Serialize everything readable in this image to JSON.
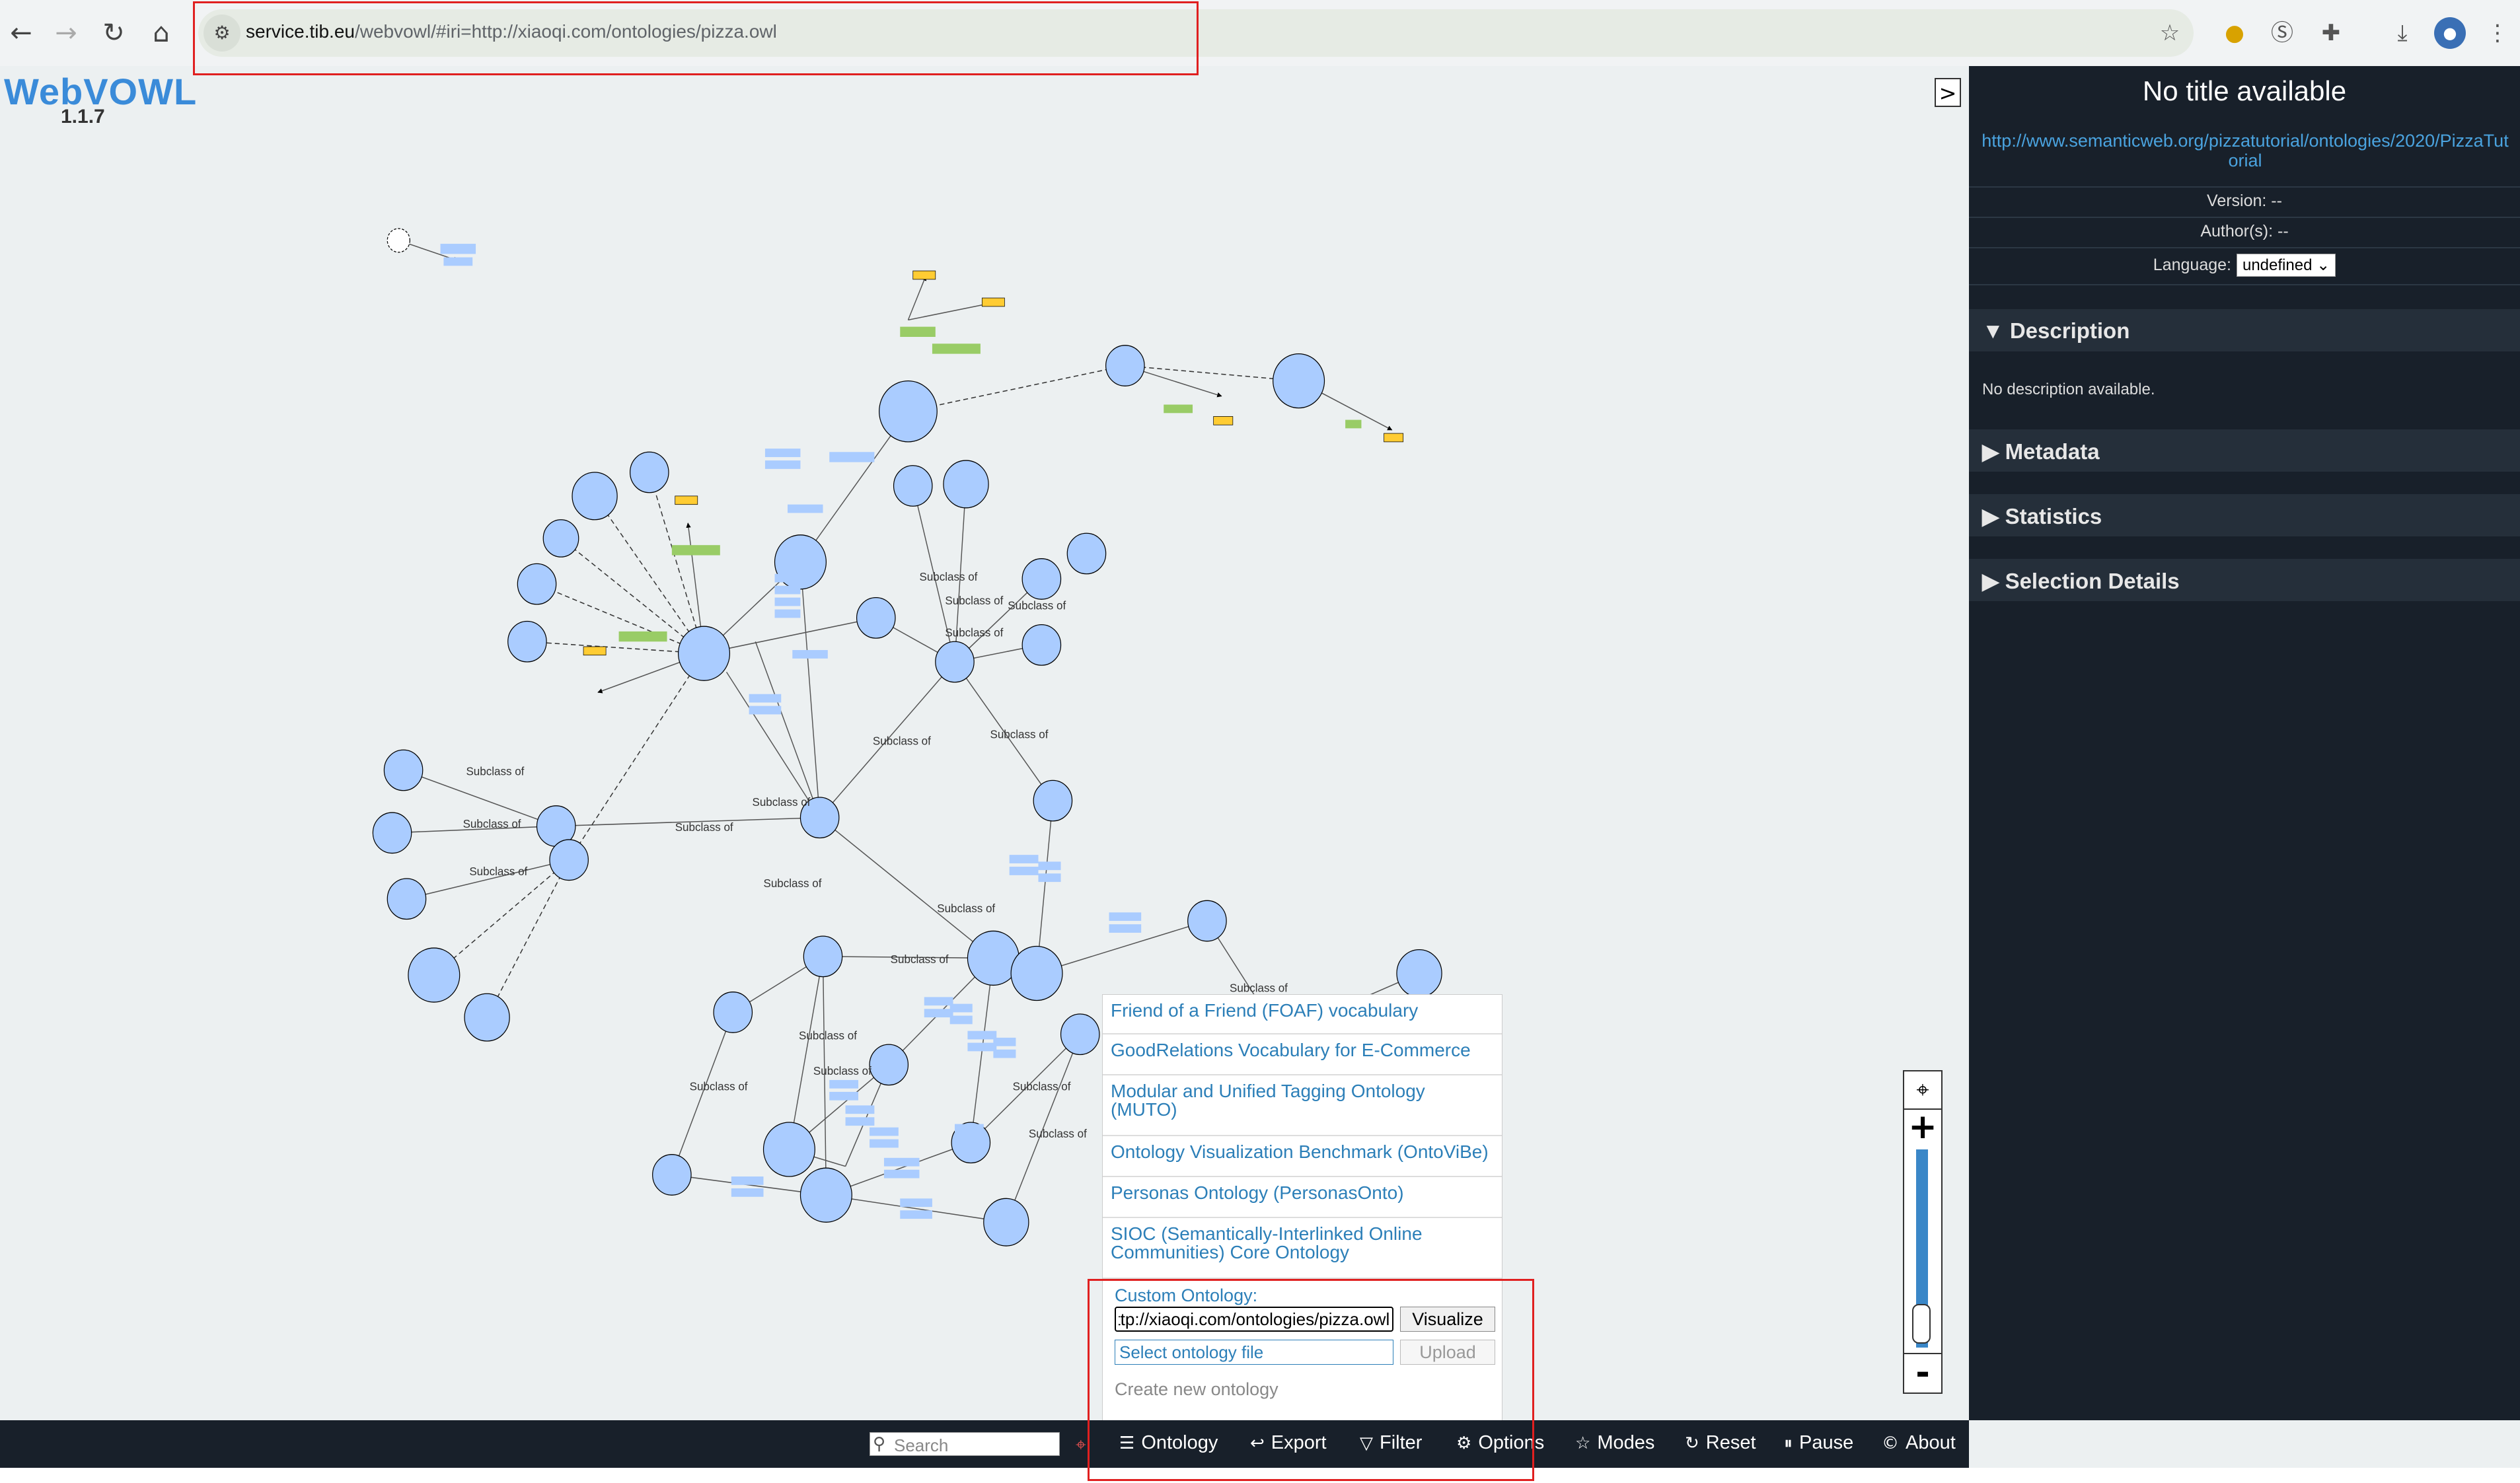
{
  "browser": {
    "url_host": "service.tib.eu",
    "url_path": "/webvowl/#iri=http://xiaoqi.com/ontologies/pizza.owl",
    "icons": [
      "back-icon",
      "forward-icon",
      "reload-icon",
      "home-icon",
      "site-info-icon",
      "bookmark-star-icon",
      "extension-medal-icon",
      "extension-s-icon",
      "extensions-puzzle-icon",
      "download-icon",
      "profile-avatar",
      "menu-kebab-icon"
    ]
  },
  "app": {
    "logo": "WebVOWL",
    "version": "1.1.7",
    "toggle_sidebar": ">"
  },
  "sidebar": {
    "title": "No title available",
    "iri": "http://www.semanticweb.org/pizzatutorial/ontologies/2020/PizzaTutorial",
    "version": "Version: --",
    "authors": "Author(s): --",
    "language_label": "Language:",
    "language_value": "undefined",
    "sections": [
      {
        "arrow": "▼",
        "label": "Description"
      },
      {
        "arrow": "▶",
        "label": "Metadata"
      },
      {
        "arrow": "▶",
        "label": "Statistics"
      },
      {
        "arrow": "▶",
        "label": "Selection Details"
      }
    ],
    "description_text": "No description available."
  },
  "zoom": {
    "locate": "⌖",
    "plus": "+",
    "minus": "-",
    "level": 0.8
  },
  "ontology_menu": {
    "items": [
      "Friend of a Friend (FOAF) vocabulary",
      "GoodRelations Vocabulary for E-Commerce",
      "Modular and Unified Tagging Ontology (MUTO)",
      "Ontology Visualization Benchmark (OntoViBe)",
      "Personas Ontology (PersonasOnto)",
      "SIOC (Semantically-Interlinked Online Communities) Core Ontology"
    ],
    "custom_label": "Custom Ontology:",
    "custom_value": "http://xiaoqi.com/ontologies/pizza.owl",
    "visualize": "Visualize",
    "select_file": "Select ontology file",
    "upload": "Upload",
    "create_new": "Create new ontology"
  },
  "bottom_bar": {
    "search_placeholder": "Search",
    "items": [
      {
        "icon": "☰",
        "label": "Ontology"
      },
      {
        "icon": "↩",
        "label": "Export"
      },
      {
        "icon": "▽",
        "label": "Filter"
      },
      {
        "icon": "⚙",
        "label": "Options"
      },
      {
        "icon": "☆",
        "label": "Modes"
      },
      {
        "icon": "↻",
        "label": "Reset"
      },
      {
        "icon": "⏸",
        "label": "Pause"
      },
      {
        "icon": "©",
        "label": "About"
      }
    ]
  },
  "graph": {
    "edge_label": "Subclass of",
    "colors": {
      "class": "#aaccff",
      "property": "#aaccff",
      "datatype": "#ffcc33",
      "datatype_property": "#99cc66",
      "stroke": "#000000"
    }
  }
}
